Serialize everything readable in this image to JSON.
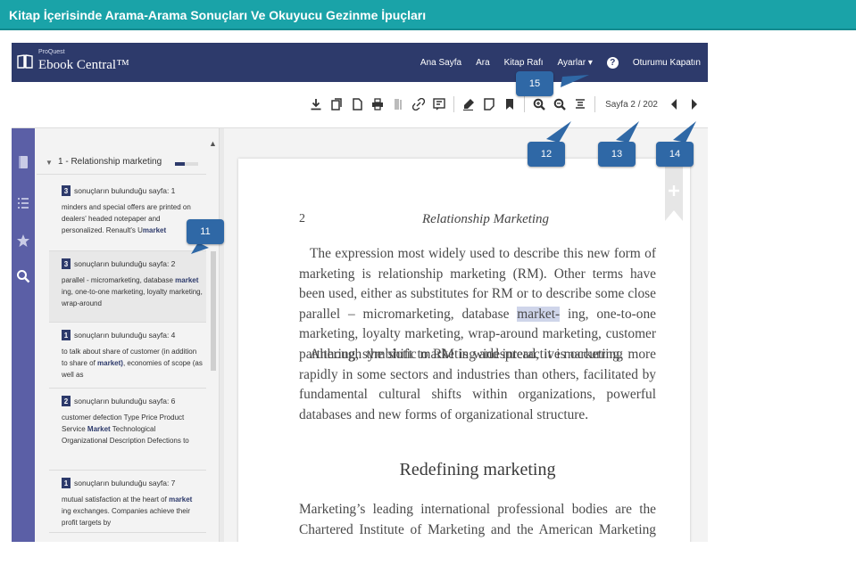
{
  "slide": {
    "title": "Kitap İçerisinde Arama-Arama Sonuçları Ve Okuyucu Gezinme İpuçları"
  },
  "app": {
    "brand_small": "ProQuest",
    "brand_main": "Ebook Central™",
    "nav": {
      "home": "Ana Sayfa",
      "search": "Ara",
      "bookshelf": "Kitap Rafı",
      "settings": "Ayarlar ▾",
      "help": "?",
      "logout": "Oturumu Kapatın"
    }
  },
  "toolbar": {
    "icons": [
      "download-icon",
      "copy-pages-icon",
      "document-icon",
      "print-icon",
      "book-icon",
      "link-icon",
      "cite-icon",
      "highlight-icon",
      "note-icon",
      "bookmark-icon",
      "zoom-in-icon",
      "zoom-out-icon",
      "fit-page-icon",
      "prev-page-icon",
      "next-page-icon"
    ],
    "page_label": "Sayfa 2 / 202"
  },
  "results": {
    "chapter": "1 - Relationship marketing",
    "chapter_progress": 0.42,
    "items": [
      {
        "count": "3",
        "label": "sonuçların bulunduğu sayfa: 1",
        "text_before": "minders and special offers are printed on dealers' headed notepaper and personalized. Renault's U",
        "match": "market",
        "text_after": ""
      },
      {
        "count": "3",
        "label": "sonuçların bulunduğu sayfa: 2",
        "text_before": "parallel - micromarketing, database ",
        "match": "market",
        "text_after": " ing, one-to-one marketing, loyalty marketing, wrap-around"
      },
      {
        "count": "1",
        "label": "sonuçların bulunduğu sayfa: 4",
        "text_before": "to talk about share of customer (in addition to share of ",
        "match": "market)",
        "text_after": ", economies of scope (as well as"
      },
      {
        "count": "2",
        "label": "sonuçların bulunduğu sayfa: 6",
        "text_before": "customer defection Type Price Product Service ",
        "match": "Market",
        "text_after": " Technological Organizational Description Defections to"
      },
      {
        "count": "1",
        "label": "sonuçların bulunduğu sayfa: 7",
        "text_before": "mutual satisfaction at the heart of ",
        "match": "market",
        "text_after": " ing exchanges. Companies achieve their profit targets by"
      }
    ]
  },
  "book": {
    "page_number": "2",
    "running_head": "Relationship Marketing",
    "p1_before": "The expression most widely used to describe this new form of marketing is relationship marketing (RM). Other terms have been used, either as substitutes for RM or to describe some close parallel – micromarketing, database ",
    "p1_match": "market-",
    "p1_after": " ing, one-to-one marketing, loyalty marketing, wrap-around marketing, customer partnering, symbiotic marketing and interactive marketing.",
    "p2": "Although the shift to RM is widespread, it is occurring more rapidly in some sectors and industries than others, facilitated by fundamental cultural shifts within organizations, powerful databases and new forms of organizational structure.",
    "subheading": "Redefining marketing",
    "p3": "Marketing’s leading international professional bodies are the Chartered Institute of Marketing and the American Marketing Association. They offer the"
  },
  "callouts": {
    "c11": "11",
    "c12": "12",
    "c13": "13",
    "c14": "14",
    "c15": "15"
  },
  "colors": {
    "slide_header": "#1aa3a8",
    "app_topbar": "#2d3a6b",
    "left_rail": "#5b5fa6",
    "callout": "#2f68a6",
    "search_highlight": "#cfd5ea"
  }
}
